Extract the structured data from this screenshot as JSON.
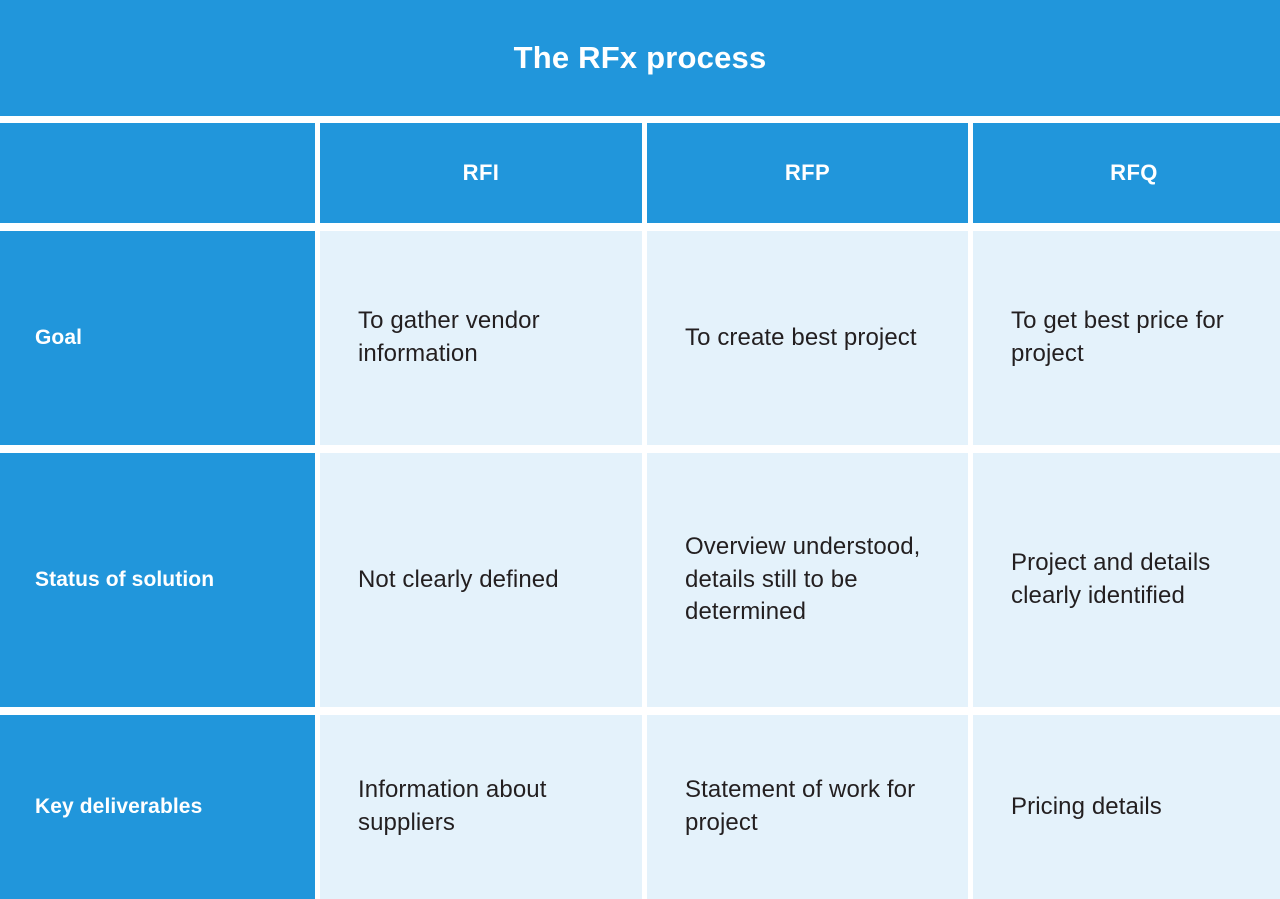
{
  "title": "The RFx process",
  "colors": {
    "brand_blue": "#2196DB",
    "cell_light_blue": "#E4F2FB",
    "header_text": "#FFFFFF",
    "body_text": "#231F20",
    "page_background": "#FFFFFF"
  },
  "table": {
    "corner_label": "",
    "column_headers": [
      "RFI",
      "RFP",
      "RFQ"
    ],
    "rows": [
      {
        "label": "Goal",
        "cells": [
          "To gather vendor information",
          "To create best project",
          "To get best price for project"
        ]
      },
      {
        "label": "Status of solution",
        "cells": [
          "Not clearly defined",
          "Overview understood, details still to be determined",
          "Project and details clearly identified"
        ]
      },
      {
        "label": "Key deliverables",
        "cells": [
          "Information about suppliers",
          "Statement of work for project",
          "Pricing details"
        ]
      }
    ]
  }
}
